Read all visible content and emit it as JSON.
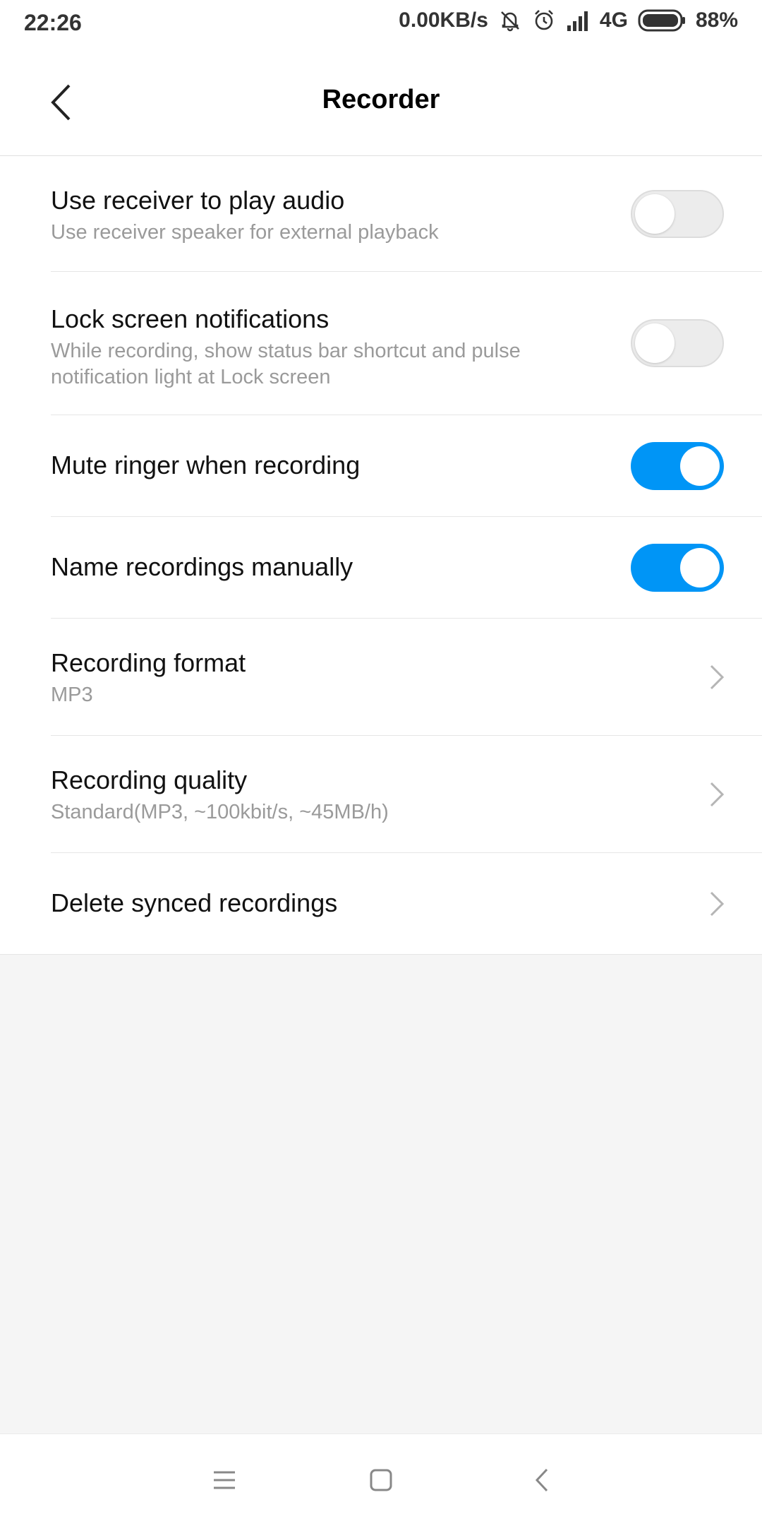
{
  "status_bar": {
    "time": "22:26",
    "net_speed": "0.00KB/s",
    "network": "4G",
    "battery_level": "88%",
    "icons": [
      "mute-icon",
      "alarm-icon",
      "signal-icon",
      "battery-icon"
    ]
  },
  "header": {
    "title": "Recorder",
    "back_icon": "back-arrow-icon"
  },
  "settings": [
    {
      "title": "Use receiver to play audio",
      "subtitle": "Use receiver speaker for external playback",
      "control": "toggle",
      "enabled": false
    },
    {
      "title": "Lock screen notifications",
      "subtitle": "While recording, show status bar shortcut and pulse notification light at Lock screen",
      "control": "toggle",
      "enabled": false
    },
    {
      "title": "Mute ringer when recording",
      "control": "toggle",
      "enabled": true
    },
    {
      "title": "Name recordings manually",
      "control": "toggle",
      "enabled": true
    },
    {
      "title": "Recording format",
      "subtitle": "MP3",
      "control": "chevron"
    },
    {
      "title": "Recording quality",
      "subtitle": "Standard(MP3, ~100kbit/s, ~45MB/h)",
      "control": "chevron"
    },
    {
      "title": "Delete synced recordings",
      "control": "chevron"
    }
  ],
  "nav_bar": {
    "icons": [
      "menu-icon",
      "home-icon",
      "back-icon"
    ]
  },
  "colors": {
    "accent": "#0095f6",
    "background": "#f5f5f5",
    "secondary_text": "#9a9a9a"
  }
}
